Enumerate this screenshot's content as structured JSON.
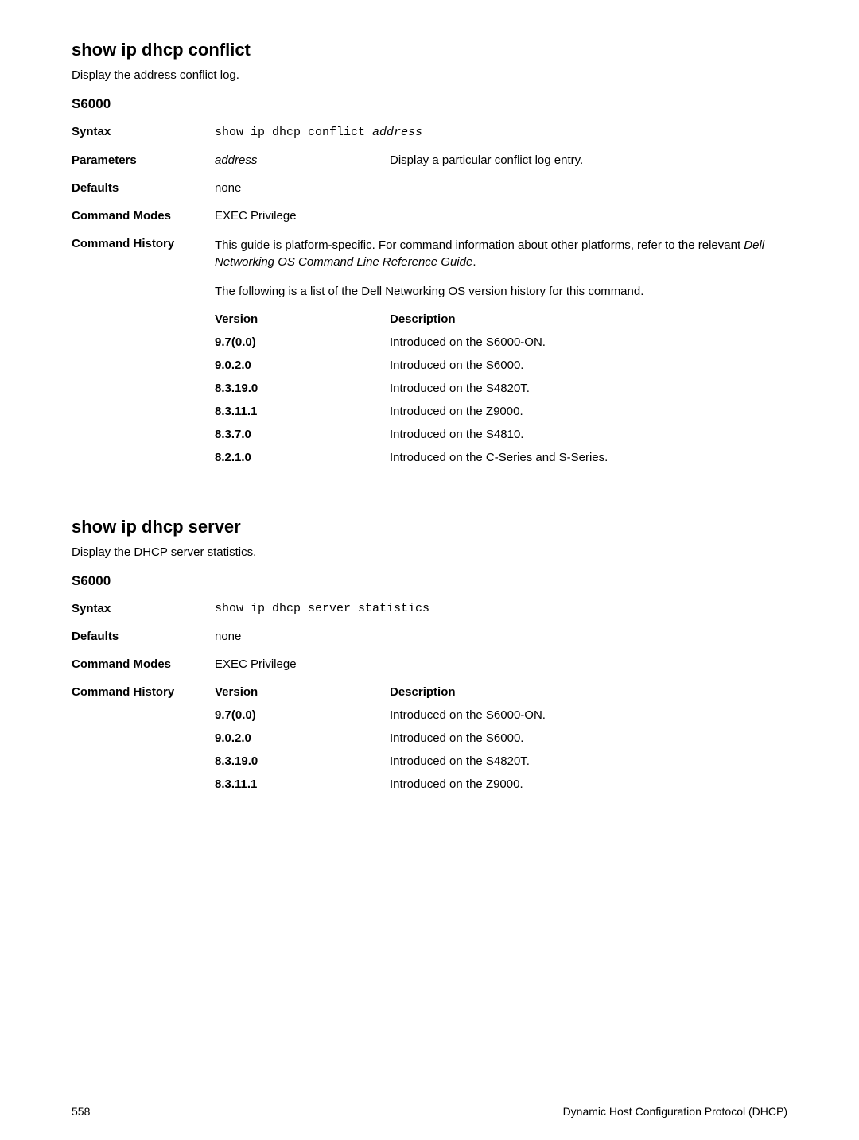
{
  "section1": {
    "title": "show ip dhcp conflict",
    "subtitle": "Display the address conflict log.",
    "model": "S6000",
    "rows": {
      "syntax_label": "Syntax",
      "syntax_cmd_prefix": "show ip dhcp conflict ",
      "syntax_cmd_arg": "address",
      "parameters_label": "Parameters",
      "param_key": "address",
      "param_desc": "Display a particular conflict log entry.",
      "defaults_label": "Defaults",
      "defaults_value": "none",
      "modes_label": "Command Modes",
      "modes_value": "EXEC Privilege",
      "history_label": "Command History",
      "history_para1_a": "This guide is platform-specific. For command information about other platforms, refer to the relevant ",
      "history_para1_b": "Dell Networking OS Command Line Reference Guide",
      "history_para1_c": ".",
      "history_para2": "The following is a list of the Dell Networking OS version history for this command.",
      "version_header_l": "Version",
      "version_header_r": "Description",
      "versions": [
        {
          "v": "9.7(0.0)",
          "d": "Introduced on the S6000-ON."
        },
        {
          "v": "9.0.2.0",
          "d": "Introduced on the S6000."
        },
        {
          "v": "8.3.19.0",
          "d": "Introduced on the S4820T."
        },
        {
          "v": "8.3.11.1",
          "d": "Introduced on the Z9000."
        },
        {
          "v": "8.3.7.0",
          "d": "Introduced on the S4810."
        },
        {
          "v": "8.2.1.0",
          "d": "Introduced on the C-Series and S-Series."
        }
      ]
    }
  },
  "section2": {
    "title": "show ip dhcp server",
    "subtitle": "Display the DHCP server statistics.",
    "model": "S6000",
    "rows": {
      "syntax_label": "Syntax",
      "syntax_cmd": "show ip dhcp server statistics",
      "defaults_label": "Defaults",
      "defaults_value": "none",
      "modes_label": "Command Modes",
      "modes_value": "EXEC Privilege",
      "history_label": "Command History",
      "version_header_l": "Version",
      "version_header_r": "Description",
      "versions": [
        {
          "v": "9.7(0.0)",
          "d": "Introduced on the S6000-ON."
        },
        {
          "v": "9.0.2.0",
          "d": "Introduced on the S6000."
        },
        {
          "v": "8.3.19.0",
          "d": "Introduced on the S4820T."
        },
        {
          "v": "8.3.11.1",
          "d": "Introduced on the Z9000."
        }
      ]
    }
  },
  "footer": {
    "page": "558",
    "title": "Dynamic Host Configuration Protocol (DHCP)"
  }
}
